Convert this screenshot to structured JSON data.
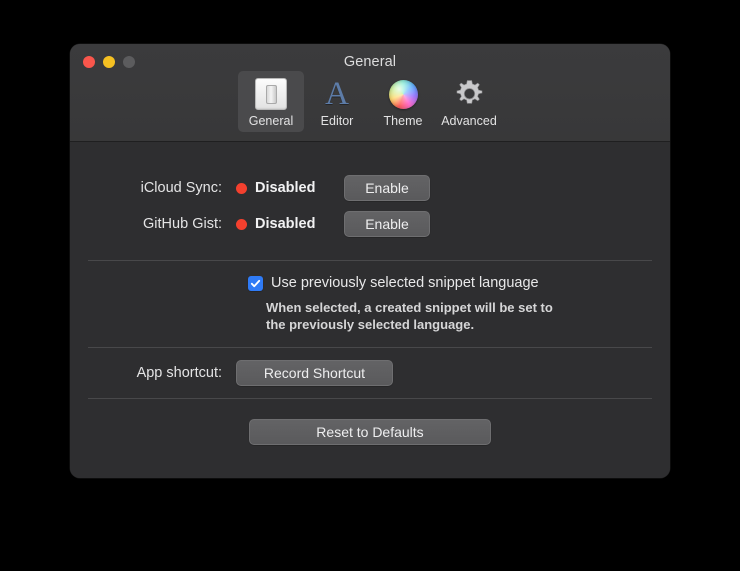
{
  "window": {
    "title": "General",
    "controls": [
      {
        "name": "close",
        "color": "#f9564c"
      },
      {
        "name": "minimize",
        "color": "#f5c022"
      },
      {
        "name": "zoom",
        "color": "#5c5c5e"
      }
    ]
  },
  "toolbar": {
    "tabs": [
      {
        "label": "General",
        "icon": "light-switch-icon",
        "selected": true
      },
      {
        "label": "Editor",
        "icon": "serif-a-icon",
        "selected": false
      },
      {
        "label": "Theme",
        "icon": "color-wheel-icon",
        "selected": false
      },
      {
        "label": "Advanced",
        "icon": "gear-icon",
        "selected": false
      }
    ]
  },
  "settings": {
    "icloud": {
      "label": "iCloud Sync:",
      "status": "Disabled",
      "status_color": "#f4402e",
      "button": "Enable"
    },
    "gist": {
      "label": "GitHub Gist:",
      "status": "Disabled",
      "status_color": "#f4402e",
      "button": "Enable"
    },
    "snippet_language": {
      "checkbox_label": "Use previously selected snippet language",
      "checked": true,
      "help_line_1": "When selected, a created snippet will be set to",
      "help_line_2": "the previously selected language."
    },
    "shortcut": {
      "label": "App shortcut:",
      "button": "Record Shortcut"
    },
    "reset": {
      "button": "Reset to Defaults"
    }
  }
}
